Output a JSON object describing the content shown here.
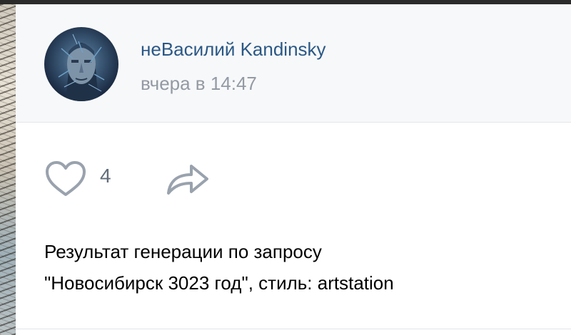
{
  "post": {
    "author": "неВасилий Kandinsky",
    "timestamp": "вчера в 14:47",
    "avatar_icon": "ai-portrait-avatar",
    "likes": "4",
    "like_icon": "heart-outline-icon",
    "share_icon": "share-arrow-icon",
    "text_lines": [
      "Результат генерации по запросу",
      "\"Новосибирск 3023 год\", стиль: artstation"
    ]
  },
  "colors": {
    "author_link": "#2a5885",
    "secondary_text": "#939aa3",
    "icon_gray": "#99a2ad",
    "header_bg": "#f7f8fa"
  }
}
